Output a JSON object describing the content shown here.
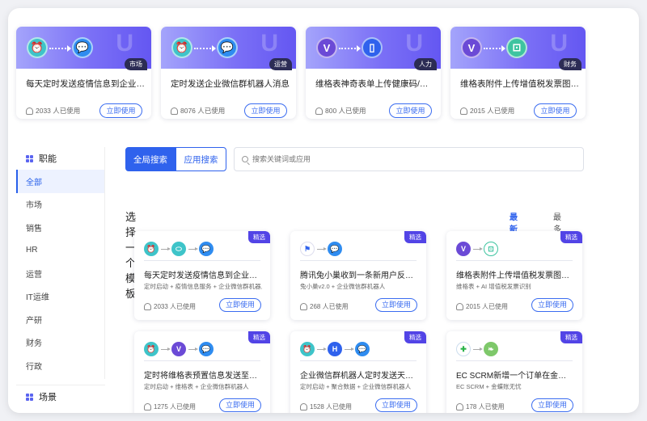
{
  "top_cards": [
    {
      "title": "每天定时发送疫情信息到企业微...",
      "uses": "2033 人已使用",
      "button": "立即使用",
      "tag": "市场",
      "watermark": "U",
      "icons": [
        "alarm-icon",
        "wechat-bot-icon"
      ]
    },
    {
      "title": "定时发送企业微信群机器人消息",
      "uses": "8076 人已使用",
      "button": "立即使用",
      "tag": "运营",
      "watermark": "U",
      "icons": [
        "alarm-icon",
        "wechat-bot-icon"
      ]
    },
    {
      "title": "维格表神奇表单上传健康码/行...",
      "uses": "800 人已使用",
      "button": "立即使用",
      "tag": "人力",
      "watermark": "U",
      "icons": [
        "vika-icon",
        "form-icon"
      ]
    },
    {
      "title": "维格表附件上传增值税发票图片...",
      "uses": "2015 人已使用",
      "button": "立即使用",
      "tag": "财务",
      "watermark": "U",
      "icons": [
        "vika-icon",
        "invoice-ocr-icon"
      ]
    }
  ],
  "sidebar": {
    "header": "职能",
    "items": [
      {
        "label": "全部",
        "active": true
      },
      {
        "label": "市场"
      },
      {
        "label": "销售"
      },
      {
        "label": "HR"
      },
      {
        "label": "运营"
      },
      {
        "label": "IT运维"
      },
      {
        "label": "产研"
      },
      {
        "label": "财务"
      },
      {
        "label": "行政"
      }
    ],
    "scene_header": "场景"
  },
  "search": {
    "global": "全局搜索",
    "app": "应用搜索",
    "placeholder": "搜索关键词或应用"
  },
  "section": {
    "title": "选择一个模板",
    "tab_new": "最新上传",
    "tab_view": "最多浏览"
  },
  "templates": [
    {
      "title": "每天定时发送疫情信息到企业微信...",
      "sub": "定时启动 + 疫情信息服务 + 企业微信群机器人",
      "uses": "2033 人已使用",
      "button": "立即使用",
      "badge": "精选",
      "icons": [
        "alarm-icon",
        "epidemic-service-icon",
        "wechat-bot-icon"
      ]
    },
    {
      "title": "腾讯兔小巢收到一条新用户反馈自...",
      "sub": "兔小巢v2.0 + 企业微信群机器人",
      "uses": "268 人已使用",
      "button": "立即使用",
      "badge": "精选",
      "icons": [
        "txc-icon",
        "wechat-bot-icon"
      ]
    },
    {
      "title": "维格表附件上传增值税发票图片并...",
      "sub": "维格表 + AI 增值税发票识别",
      "uses": "2015 人已使用",
      "button": "立即使用",
      "badge": "精选",
      "icons": [
        "vika-icon",
        "invoice-ocr-icon"
      ]
    },
    {
      "title": "定时将维格表预置信息发送至企业...",
      "sub": "定时启动 + 维格表 + 企业微信群机器人",
      "uses": "1275 人已使用",
      "button": "立即使用",
      "badge": "精选",
      "icons": [
        "alarm-icon",
        "vika-icon",
        "wechat-bot-icon"
      ]
    },
    {
      "title": "企业微信群机器人定时发送天气预...",
      "sub": "定时启动 + 聚合数据 + 企业微信群机器人",
      "uses": "1528 人已使用",
      "button": "立即使用",
      "badge": "精选",
      "icons": [
        "alarm-icon",
        "juhe-data-icon",
        "wechat-bot-icon"
      ]
    },
    {
      "title": "EC SCRM新增一个订单在金蝶账...",
      "sub": "EC SCRM + 金蝶账无忧",
      "uses": "178 人已使用",
      "button": "立即使用",
      "badge": "精选",
      "icons": [
        "ec-scrm-icon",
        "kingdee-icon"
      ]
    }
  ],
  "colors": {
    "accent": "#2f62ed",
    "tag_bg": "#2c2c55",
    "badge_bg": "#5244e6",
    "teal": "#3ec4c9",
    "blue": "#2f8cf0",
    "purple": "#6b4ad6"
  }
}
